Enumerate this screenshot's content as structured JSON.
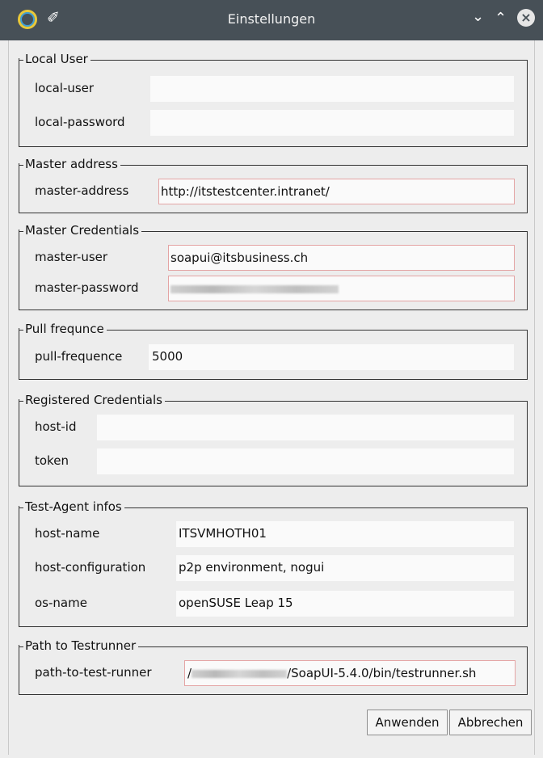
{
  "window": {
    "title": "Einstellungen",
    "min_glyph": "⌄",
    "max_glyph": "⌃",
    "close_glyph": "×",
    "pin_glyph": "✐"
  },
  "groups": {
    "local_user": {
      "legend": "Local User",
      "user_label": "local-user",
      "user_value": "",
      "password_label": "local-password",
      "password_value": ""
    },
    "master_address": {
      "legend": "Master address",
      "label": "master-address",
      "value": "http://itstestcenter.intranet/"
    },
    "master_credentials": {
      "legend": "Master Credentials",
      "user_label": "master-user",
      "user_value": "soapui@itsbusiness.ch",
      "password_label": "master-password"
    },
    "pull": {
      "legend": "Pull frequnce",
      "label": "pull-frequence",
      "value": "5000"
    },
    "registered": {
      "legend": "Registered Credentials",
      "host_label": "host-id",
      "host_value": "",
      "token_label": "token",
      "token_value": ""
    },
    "agent": {
      "legend": "Test-Agent infos",
      "hostname_label": "host-name",
      "hostname_value": "ITSVMHOTH01",
      "config_label": "host-configuration",
      "config_value": "p2p environment, nogui",
      "os_label": "os-name",
      "os_value": "openSUSE Leap 15"
    },
    "testrunner": {
      "legend": "Path to Testrunner",
      "label": "path-to-test-runner",
      "value_prefix": "/",
      "value_suffix": "/SoapUI-5.4.0/bin/testrunner.sh"
    }
  },
  "buttons": {
    "apply": "Anwenden",
    "cancel": "Abbrechen"
  },
  "colors": {
    "titlebar": "#475057",
    "dialog_bg": "#ededed",
    "field_bg": "#fafafa",
    "required_border": "#e4a4a4"
  }
}
